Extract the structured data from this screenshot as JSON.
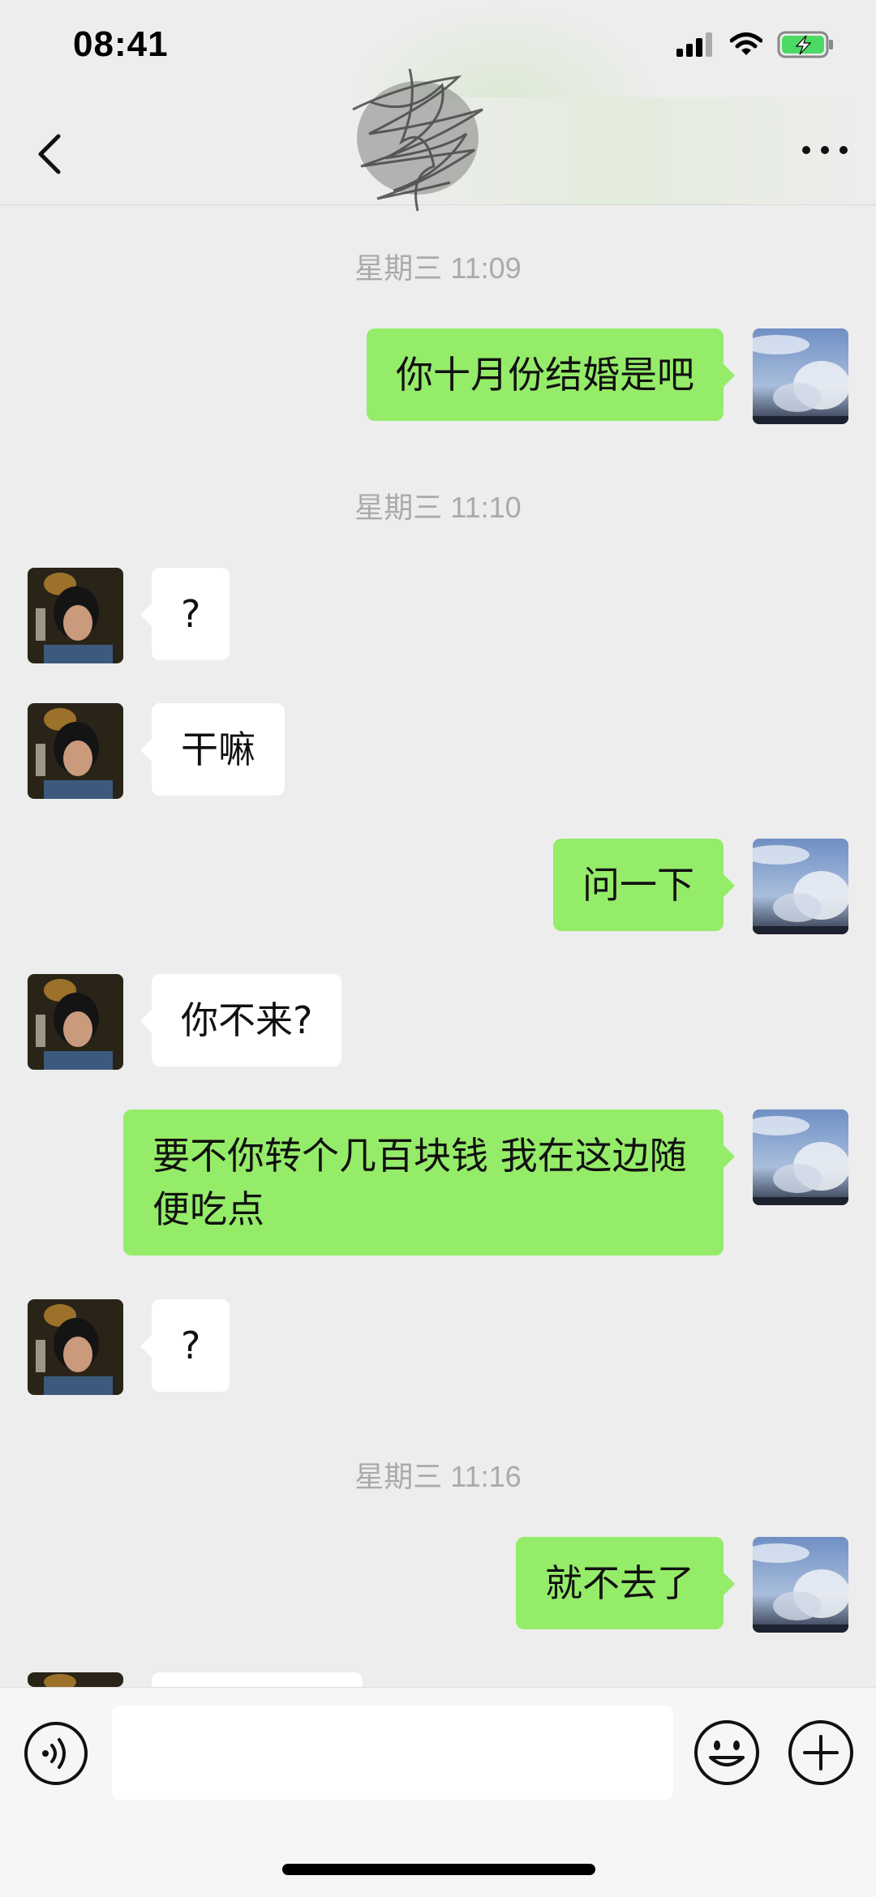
{
  "status_bar": {
    "time": "08:41"
  },
  "chat": {
    "items": [
      {
        "type": "timestamp",
        "text": "星期三 11:09"
      },
      {
        "type": "message",
        "side": "out",
        "text": "你十月份结婚是吧"
      },
      {
        "type": "timestamp",
        "text": "星期三 11:10"
      },
      {
        "type": "message",
        "side": "in",
        "text": "?"
      },
      {
        "type": "message",
        "side": "in",
        "text": "干嘛"
      },
      {
        "type": "message",
        "side": "out",
        "text": "问一下"
      },
      {
        "type": "message",
        "side": "in",
        "text": "你不来?"
      },
      {
        "type": "message",
        "side": "out",
        "text": "要不你转个几百块钱 我在这边随便吃点"
      },
      {
        "type": "message",
        "side": "in",
        "text": "?"
      },
      {
        "type": "timestamp",
        "text": "星期三 11:16"
      },
      {
        "type": "message",
        "side": "out",
        "text": "就不去了"
      }
    ]
  },
  "icons": {
    "back": "back-chevron-icon",
    "more": "more-dots-icon",
    "voice": "voice-icon",
    "emoji": "emoji-icon",
    "plus": "plus-icon"
  },
  "colors": {
    "outgoing_bubble": "#95ec69",
    "incoming_bubble": "#ffffff",
    "background": "#ededed"
  }
}
